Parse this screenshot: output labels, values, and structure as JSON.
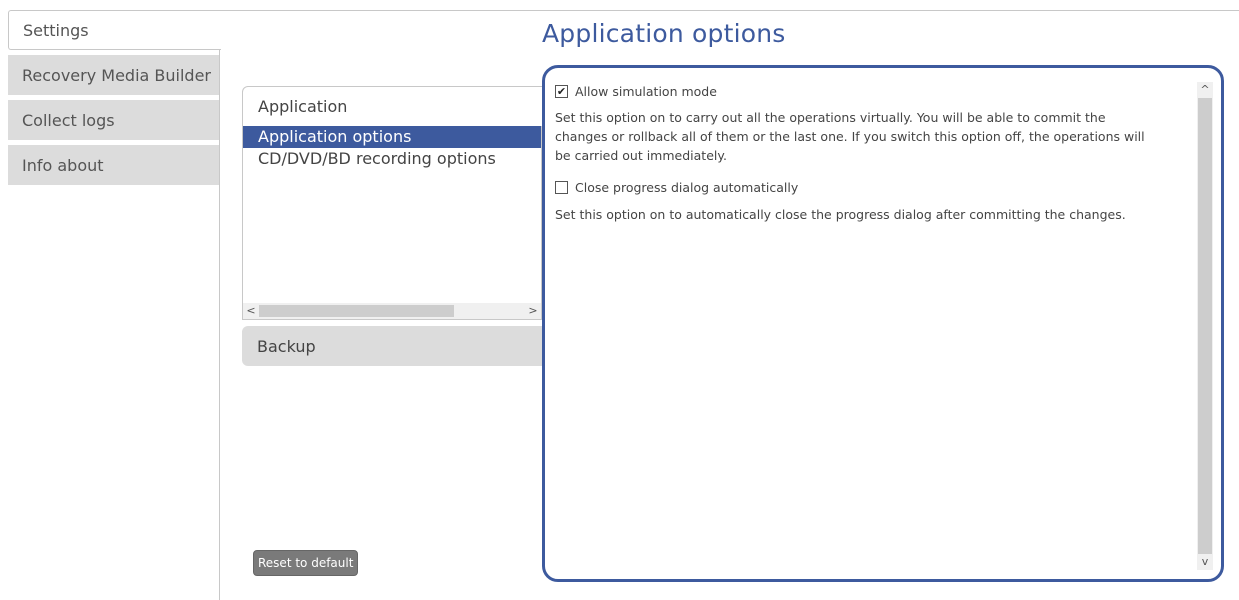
{
  "nav": {
    "tabs": [
      {
        "label": "Settings",
        "active": true
      },
      {
        "label": "Recovery Media Builder",
        "active": false
      },
      {
        "label": "Collect logs",
        "active": false
      },
      {
        "label": "Info about",
        "active": false
      }
    ]
  },
  "page_title": "Application options",
  "tree": {
    "application_group": {
      "label": "Application",
      "items": [
        "Application options",
        "CD/DVD/BD recording options"
      ],
      "selected": "Application options"
    },
    "backup_group": {
      "label": "Backup"
    }
  },
  "reset_button": "Reset to default",
  "options": {
    "simulation": {
      "label": "Allow simulation mode",
      "checked": true,
      "description": "Set this option on to carry out all the operations virtually. You will be able to commit the changes or rollback all of them or the last one. If you switch this option off, the operations will be carried out immediately."
    },
    "close_progress": {
      "label": "Close progress dialog automatically",
      "checked": false,
      "description": "Set this option on to automatically close the progress dialog after committing the changes."
    }
  },
  "icons": {
    "checked_mark": "✔",
    "scroll_left": "<",
    "scroll_right": ">",
    "scroll_up": "^",
    "scroll_down": "v"
  },
  "colors": {
    "accent": "#3d5a9e",
    "tab_inactive": "#dcdcdc"
  }
}
